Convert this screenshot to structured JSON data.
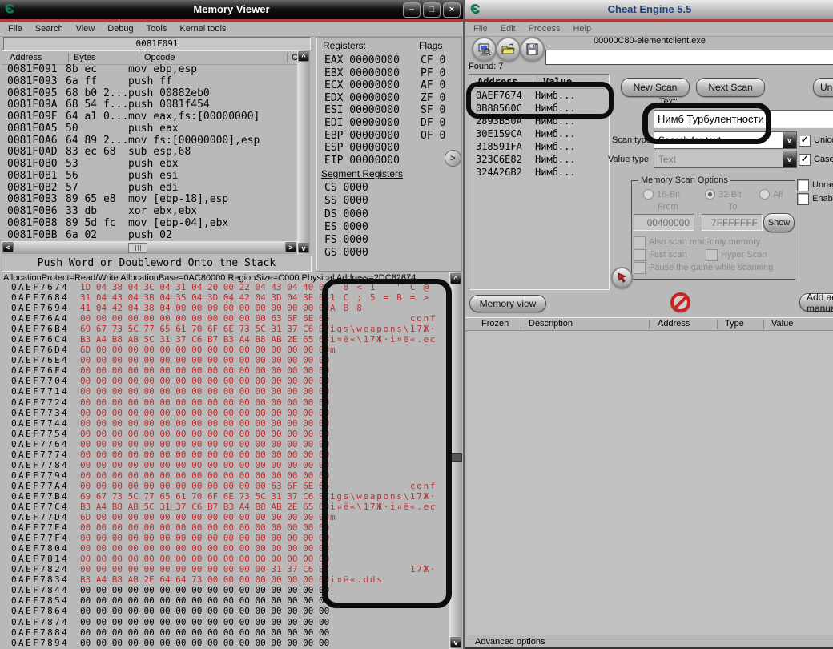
{
  "colors": {
    "accent_red_line": "#b43a3a",
    "hex_changed_red": "#c03030",
    "annotation_marker": "#0d0d0d",
    "window_gray": "#b9b9b9",
    "active_title_text": "#ffffff",
    "inactive_title_text": "#24407e",
    "logo_teal": "#1c7a5f"
  },
  "memory_viewer": {
    "title": "Memory Viewer",
    "window_buttons": {
      "minimize": "–",
      "maximize": "□",
      "close": "×"
    },
    "menu": [
      "File",
      "Search",
      "View",
      "Debug",
      "Tools",
      "Kernel tools"
    ],
    "address_bar": "0081F091",
    "disasm": {
      "columns": {
        "address": "Address",
        "bytes": "Bytes",
        "opcode": "Opcode",
        "comment": "C"
      },
      "rows": [
        {
          "address": "0081F091",
          "bytes": "8b ec",
          "opcode": "mov ebp,esp"
        },
        {
          "address": "0081F093",
          "bytes": "6a ff",
          "opcode": "push ff"
        },
        {
          "address": "0081F095",
          "bytes": "68 b0 2...",
          "opcode": "push 00882eb0"
        },
        {
          "address": "0081F09A",
          "bytes": "68 54 f...",
          "opcode": "push 0081f454"
        },
        {
          "address": "0081F09F",
          "bytes": "64 a1 0...",
          "opcode": "mov eax,fs:[00000000]"
        },
        {
          "address": "0081F0A5",
          "bytes": "50",
          "opcode": "push eax"
        },
        {
          "address": "0081F0A6",
          "bytes": "64 89 2...",
          "opcode": "mov fs:[00000000],esp"
        },
        {
          "address": "0081F0AD",
          "bytes": "83 ec 68",
          "opcode": "sub esp,68"
        },
        {
          "address": "0081F0B0",
          "bytes": "53",
          "opcode": "push ebx"
        },
        {
          "address": "0081F0B1",
          "bytes": "56",
          "opcode": "push esi"
        },
        {
          "address": "0081F0B2",
          "bytes": "57",
          "opcode": "push edi"
        },
        {
          "address": "0081F0B3",
          "bytes": "89 65 e8",
          "opcode": "mov [ebp-18],esp"
        },
        {
          "address": "0081F0B6",
          "bytes": "33 db",
          "opcode": "xor ebx,ebx"
        },
        {
          "address": "0081F0B8",
          "bytes": "89 5d fc",
          "opcode": "mov [ebp-04],ebx"
        },
        {
          "address": "0081F0BB",
          "bytes": "6a 02",
          "opcode": "push 02"
        }
      ]
    },
    "status_bar": "Push Word or Doubleword Onto the Stack",
    "registers": {
      "title": "Registers:",
      "items": [
        {
          "name": "EAX",
          "value": "00000000"
        },
        {
          "name": "EBX",
          "value": "00000000"
        },
        {
          "name": "ECX",
          "value": "00000000"
        },
        {
          "name": "EDX",
          "value": "00000000"
        },
        {
          "name": "ESI",
          "value": "00000000"
        },
        {
          "name": "EDI",
          "value": "00000000"
        },
        {
          "name": "EBP",
          "value": "00000000"
        },
        {
          "name": "ESP",
          "value": "00000000"
        },
        {
          "name": "EIP",
          "value": "00000000"
        }
      ],
      "flags_title": "Flags",
      "flags": [
        {
          "name": "CF",
          "value": "0"
        },
        {
          "name": "PF",
          "value": "0"
        },
        {
          "name": "AF",
          "value": "0"
        },
        {
          "name": "ZF",
          "value": "0"
        },
        {
          "name": "SF",
          "value": "0"
        },
        {
          "name": "DF",
          "value": "0"
        },
        {
          "name": "OF",
          "value": "0"
        }
      ],
      "more_button": ">",
      "segment_title": "Segment Registers",
      "segments": [
        {
          "name": "CS",
          "value": "0000"
        },
        {
          "name": "SS",
          "value": "0000"
        },
        {
          "name": "DS",
          "value": "0000"
        },
        {
          "name": "ES",
          "value": "0000"
        },
        {
          "name": "FS",
          "value": "0000"
        },
        {
          "name": "GS",
          "value": "0000"
        }
      ]
    },
    "hexview": {
      "info_line": "AllocationProtect=Read/Write AllocationBase=0AC80000 RegionSize=C000 Physical Address=2DC82674",
      "rows": [
        {
          "address": "0AEF7674",
          "bytes": "1D 04 38 04 3C 04 31 04 20 00 22 04 43 04 40 04",
          "ascii": "  8 < 1   \" C @ ",
          "changed": true
        },
        {
          "address": "0AEF7684",
          "bytes": "31 04 43 04 3B 04 35 04 3D 04 42 04 3D 04 3E 04",
          "ascii": "1 C ; 5 = B = > ",
          "changed": true
        },
        {
          "address": "0AEF7694",
          "bytes": "41 04 42 04 38 04 00 00 00 00 00 00 00 00 00 00",
          "ascii": "A B 8           ",
          "changed": true
        },
        {
          "address": "0AEF76A4",
          "bytes": "00 00 00 00 00 00 00 00 00 00 00 00 63 6F 6E 66",
          "ascii": "            conf",
          "changed": true
        },
        {
          "address": "0AEF76B4",
          "bytes": "69 67 73 5C 77 65 61 70 6F 6E 73 5C 31 37 C6 B7",
          "ascii": "igs\\weapons\\17Ж·",
          "changed": true
        },
        {
          "address": "0AEF76C4",
          "bytes": "B3 A4 B8 AB 5C 31 37 C6 B7 B3 A4 B8 AB 2E 65 63",
          "ascii": "і¤ё«\\17Ж·і¤ё«.ec",
          "changed": true
        },
        {
          "address": "0AEF76D4",
          "bytes": "6D 00 00 00 00 00 00 00 00 00 00 00 00 00 00 00",
          "ascii": "m               ",
          "changed": true
        },
        {
          "address": "0AEF76E4",
          "bytes": "00 00 00 00 00 00 00 00 00 00 00 00 00 00 00 00",
          "ascii": "",
          "changed": true
        },
        {
          "address": "0AEF76F4",
          "bytes": "00 00 00 00 00 00 00 00 00 00 00 00 00 00 00 00",
          "ascii": "",
          "changed": true
        },
        {
          "address": "0AEF7704",
          "bytes": "00 00 00 00 00 00 00 00 00 00 00 00 00 00 00 00",
          "ascii": "",
          "changed": true
        },
        {
          "address": "0AEF7714",
          "bytes": "00 00 00 00 00 00 00 00 00 00 00 00 00 00 00 00",
          "ascii": "",
          "changed": true
        },
        {
          "address": "0AEF7724",
          "bytes": "00 00 00 00 00 00 00 00 00 00 00 00 00 00 00 00",
          "ascii": "",
          "changed": true
        },
        {
          "address": "0AEF7734",
          "bytes": "00 00 00 00 00 00 00 00 00 00 00 00 00 00 00 00",
          "ascii": "",
          "changed": true
        },
        {
          "address": "0AEF7744",
          "bytes": "00 00 00 00 00 00 00 00 00 00 00 00 00 00 00 00",
          "ascii": "",
          "changed": true
        },
        {
          "address": "0AEF7754",
          "bytes": "00 00 00 00 00 00 00 00 00 00 00 00 00 00 00 00",
          "ascii": "",
          "changed": true
        },
        {
          "address": "0AEF7764",
          "bytes": "00 00 00 00 00 00 00 00 00 00 00 00 00 00 00 00",
          "ascii": "",
          "changed": true
        },
        {
          "address": "0AEF7774",
          "bytes": "00 00 00 00 00 00 00 00 00 00 00 00 00 00 00 00",
          "ascii": "",
          "changed": true
        },
        {
          "address": "0AEF7784",
          "bytes": "00 00 00 00 00 00 00 00 00 00 00 00 00 00 00 00",
          "ascii": "",
          "changed": true
        },
        {
          "address": "0AEF7794",
          "bytes": "00 00 00 00 00 00 00 00 00 00 00 00 00 00 00 00",
          "ascii": "",
          "changed": true
        },
        {
          "address": "0AEF77A4",
          "bytes": "00 00 00 00 00 00 00 00 00 00 00 00 63 6F 6E 66",
          "ascii": "            conf",
          "changed": true
        },
        {
          "address": "0AEF77B4",
          "bytes": "69 67 73 5C 77 65 61 70 6F 6E 73 5C 31 37 C6 B7",
          "ascii": "igs\\weapons\\17Ж·",
          "changed": true
        },
        {
          "address": "0AEF77C4",
          "bytes": "B3 A4 B8 AB 5C 31 37 C6 B7 B3 A4 B8 AB 2E 65 63",
          "ascii": "і¤ё«\\17Ж·і¤ё«.ec",
          "changed": true
        },
        {
          "address": "0AEF77D4",
          "bytes": "6D 00 00 00 00 00 00 00 00 00 00 00 00 00 00 00",
          "ascii": "m               ",
          "changed": true
        },
        {
          "address": "0AEF77E4",
          "bytes": "00 00 00 00 00 00 00 00 00 00 00 00 00 00 00 00",
          "ascii": "",
          "changed": true
        },
        {
          "address": "0AEF77F4",
          "bytes": "00 00 00 00 00 00 00 00 00 00 00 00 00 00 00 00",
          "ascii": "",
          "changed": true
        },
        {
          "address": "0AEF7804",
          "bytes": "00 00 00 00 00 00 00 00 00 00 00 00 00 00 00 00",
          "ascii": "",
          "changed": true
        },
        {
          "address": "0AEF7814",
          "bytes": "00 00 00 00 00 00 00 00 00 00 00 00 00 00 00 00",
          "ascii": "",
          "changed": true
        },
        {
          "address": "0AEF7824",
          "bytes": "00 00 00 00 00 00 00 00 00 00 00 00 31 37 C6 B7",
          "ascii": "            17Ж·",
          "changed": true
        },
        {
          "address": "0AEF7834",
          "bytes": "B3 A4 B8 AB 2E 64 64 73 00 00 00 00 00 00 00 00",
          "ascii": "і¤ё«.dds        ",
          "changed": true
        },
        {
          "address": "0AEF7844",
          "bytes": "00 00 00 00 00 00 00 00 00 00 00 00 00 00 00 00",
          "ascii": "",
          "changed": false
        },
        {
          "address": "0AEF7854",
          "bytes": "00 00 00 00 00 00 00 00 00 00 00 00 00 00 00 00",
          "ascii": "",
          "changed": false
        },
        {
          "address": "0AEF7864",
          "bytes": "00 00 00 00 00 00 00 00 00 00 00 00 00 00 00 00",
          "ascii": "",
          "changed": false
        },
        {
          "address": "0AEF7874",
          "bytes": "00 00 00 00 00 00 00 00 00 00 00 00 00 00 00 00",
          "ascii": "",
          "changed": false
        },
        {
          "address": "0AEF7884",
          "bytes": "00 00 00 00 00 00 00 00 00 00 00 00 00 00 00 00",
          "ascii": "",
          "changed": false
        },
        {
          "address": "0AEF7894",
          "bytes": "00 00 00 00 00 00 00 00 00 00 00 00 00 00 00 00",
          "ascii": "",
          "changed": false
        }
      ]
    }
  },
  "cheat_engine": {
    "title": "Cheat Engine 5.5",
    "menu": [
      "File",
      "Edit",
      "Process",
      "Help"
    ],
    "process_label": "00000C80-elementclient.exe",
    "found_label": "Found: 7",
    "found_list": {
      "columns": {
        "address": "Address",
        "value": "Value"
      },
      "rows": [
        {
          "address": "0AEF7674",
          "value": "Нимб..."
        },
        {
          "address": "0B88560C",
          "value": "Нимб..."
        },
        {
          "address": "2893B50A",
          "value": "Нимб..."
        },
        {
          "address": "30E159CA",
          "value": "Нимб..."
        },
        {
          "address": "318591FA",
          "value": "Нимб..."
        },
        {
          "address": "323C6E82",
          "value": "Нимб..."
        },
        {
          "address": "324A26B2",
          "value": "Нимб..."
        }
      ]
    },
    "buttons": {
      "new_scan": "New Scan",
      "next_scan": "Next Scan",
      "undo_scan": "Undo scan",
      "memory_view": "Memory view",
      "add_address": "Add address manually",
      "show": "Show"
    },
    "text_field": {
      "label": "Text:",
      "value": "Нимб Турбулентности"
    },
    "scan_type": {
      "label": "Scan type",
      "value": "Search for text"
    },
    "value_type": {
      "label": "Value type",
      "value": "Text"
    },
    "checkboxes": {
      "unicode": {
        "label": "Unicode",
        "checked": true
      },
      "case_sensitive": {
        "label": "Case sensitive",
        "checked": true
      },
      "unrandomizer": {
        "label": "Unrandomizer",
        "checked": false
      },
      "enable_speedhack": {
        "label": "Enable Speedhack",
        "checked": false
      }
    },
    "scan_options": {
      "title": "Memory Scan Options",
      "radio_16bit": "16-Bit",
      "radio_32bit": "32-Bit",
      "radio_all": "All",
      "from_label": "From",
      "to_label": "To",
      "from_value": "00400000",
      "to_value": "7FFFFFFF",
      "check_readonly": "Also scan read-only memory",
      "check_fast": "Fast scan",
      "check_hyper": "Hyper Scan",
      "check_pause": "Pause the game while scanning"
    },
    "table": {
      "columns": [
        "Frozen",
        "Description",
        "Address",
        "Type",
        "Value"
      ]
    },
    "advanced_options": "Advanced options"
  }
}
